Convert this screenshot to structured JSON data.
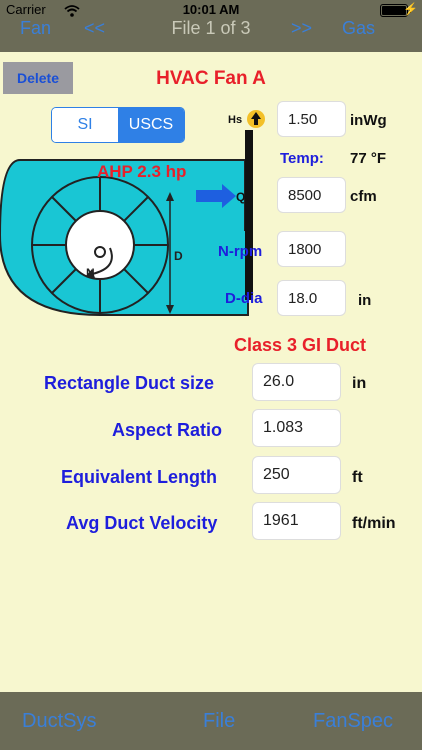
{
  "status": {
    "carrier": "Carrier",
    "time": "10:01 AM"
  },
  "nav": {
    "prev": "Fan",
    "prev_arrow": "<<",
    "title": "File 1 of 3",
    "next_arrow": ">>",
    "next": "Gas"
  },
  "header": {
    "delete_label": "Delete",
    "title": "HVAC Fan A"
  },
  "units_toggle": {
    "options": [
      "SI",
      "USCS"
    ],
    "selected": "USCS"
  },
  "fan": {
    "hs_label": "Hs",
    "hs_value": "1.50",
    "hs_unit": "inWg",
    "temp_label": "Temp:",
    "temp_value": "77 °F",
    "ahp": "AHP 2.3 hp",
    "q_label": "Q",
    "q_value": "8500",
    "q_unit": "cfm",
    "d_label": "D",
    "n_label": "N",
    "nrpm_label": "N-rpm",
    "nrpm_value": "1800",
    "ddia_label": "D-dia",
    "ddia_value": "18.0",
    "ddia_unit": "in"
  },
  "duct": {
    "class": "Class 3 GI Duct",
    "rect_label": "Rectangle Duct size",
    "rect_value": "26.0",
    "rect_unit": "in",
    "aspect_label": "Aspect Ratio",
    "aspect_value": "1.083",
    "eqlen_label": "Equivalent Length",
    "eqlen_value": "250",
    "eqlen_unit": "ft",
    "vel_label": "Avg Duct Velocity",
    "vel_value": "1961",
    "vel_unit": "ft/min"
  },
  "tabs": [
    "DuctSys",
    "File",
    "FanSpec"
  ]
}
